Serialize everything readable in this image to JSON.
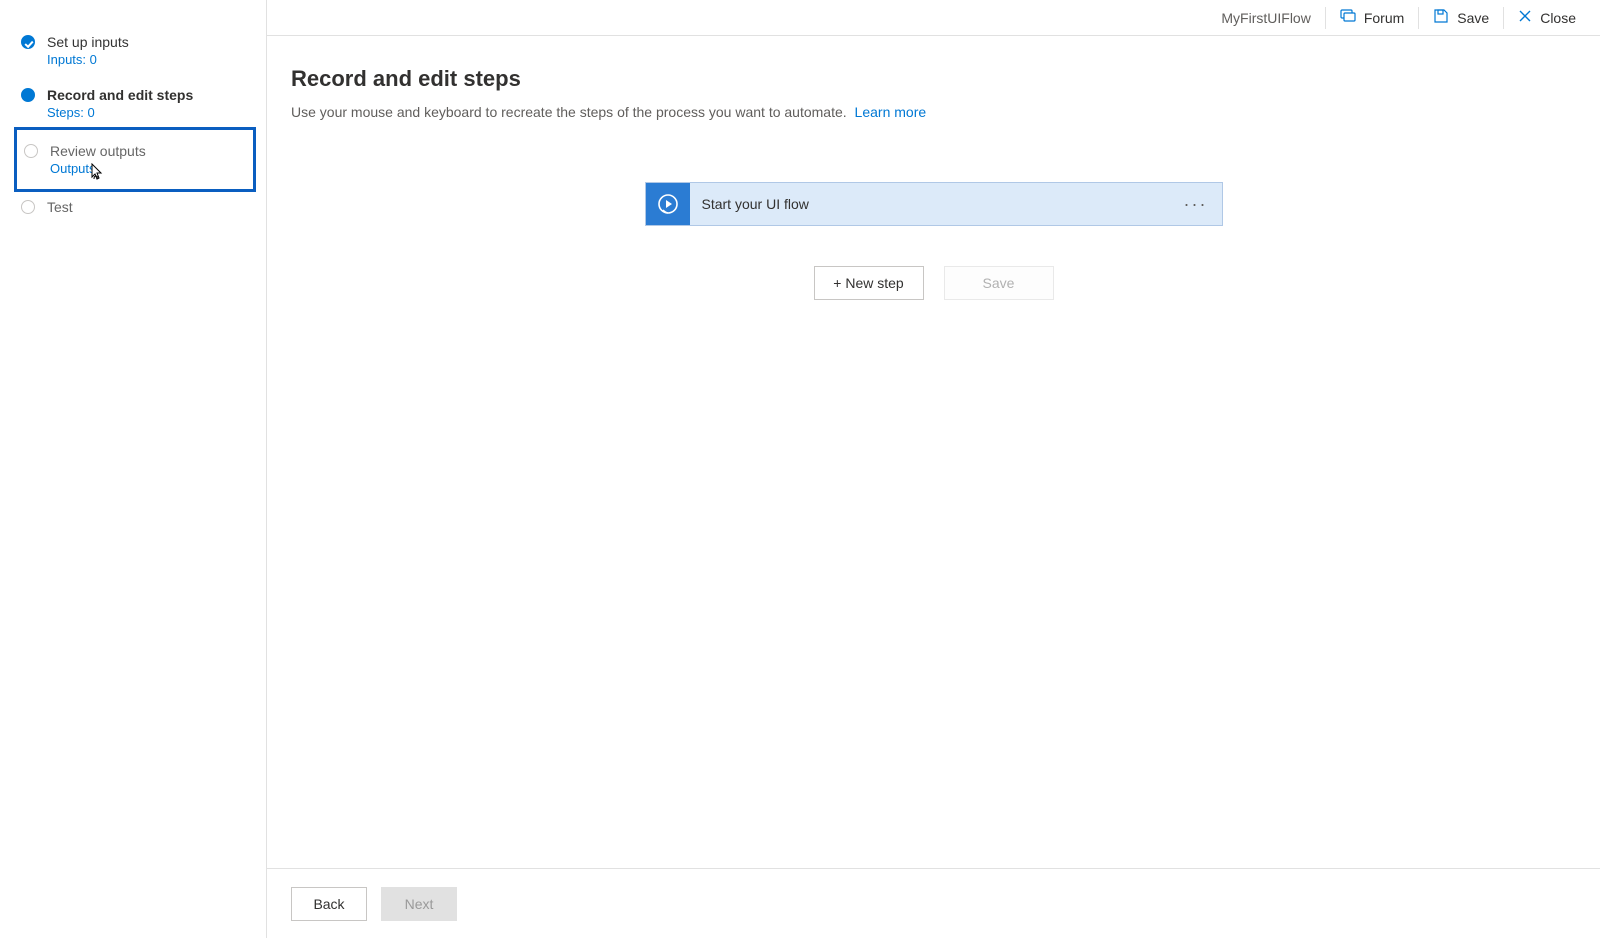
{
  "header": {
    "flow_name": "MyFirstUIFlow",
    "forum_label": "Forum",
    "save_label": "Save",
    "close_label": "Close"
  },
  "sidebar": {
    "steps": [
      {
        "title": "Set up inputs",
        "sub": "Inputs: 0"
      },
      {
        "title": "Record and edit steps",
        "sub": "Steps: 0"
      },
      {
        "title": "Review outputs",
        "sub": "Outputs"
      },
      {
        "title": "Test",
        "sub": ""
      }
    ]
  },
  "main": {
    "title": "Record and edit steps",
    "description": "Use your mouse and keyboard to recreate the steps of the process you want to automate.",
    "learn_more": "Learn more",
    "flow_card_label": "Start your UI flow",
    "new_step_label": "+ New step",
    "save_label": "Save"
  },
  "footer": {
    "back_label": "Back",
    "next_label": "Next"
  }
}
